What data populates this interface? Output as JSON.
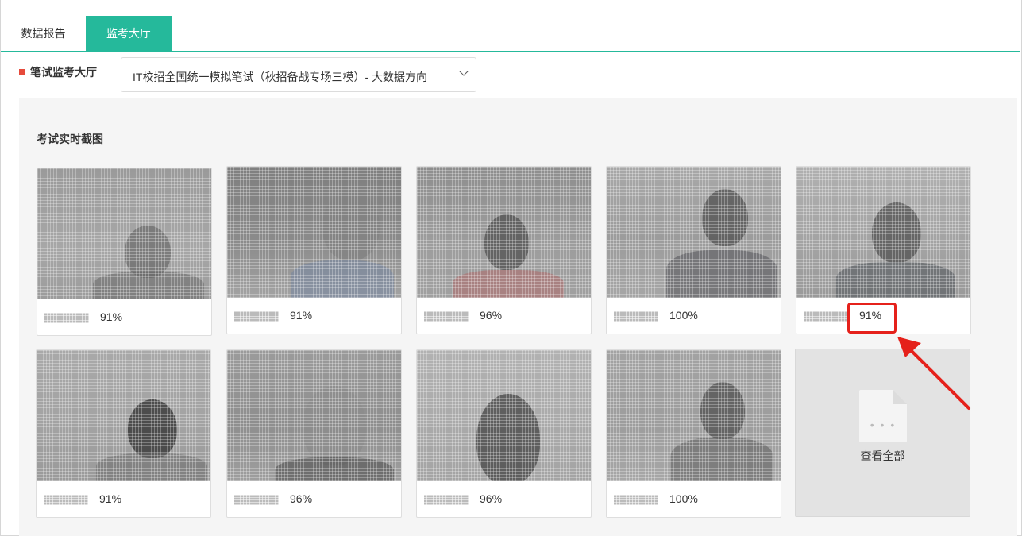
{
  "tabs": [
    {
      "label": "数据报告",
      "active": false
    },
    {
      "label": "监考大厅",
      "active": true
    }
  ],
  "toolbar": {
    "title": "笔试监考大厅",
    "exam_select": "IT校招全国统一模拟笔试（秋招备战专场三模）- 大数据方向"
  },
  "panel": {
    "title": "考试实时截图",
    "cards": [
      {
        "percent": "91%"
      },
      {
        "percent": "91%"
      },
      {
        "percent": "96%"
      },
      {
        "percent": "100%"
      },
      {
        "percent": "91%"
      },
      {
        "percent": "91%"
      },
      {
        "percent": "96%"
      },
      {
        "percent": "96%"
      },
      {
        "percent": "100%"
      }
    ],
    "view_all_label": "查看全部"
  },
  "colors": {
    "accent": "#25b99b",
    "marker": "#e64a3b",
    "annotation": "#e5211b"
  },
  "icons": {
    "dropdown": "chevron-down-icon",
    "view_all": "document-icon"
  }
}
